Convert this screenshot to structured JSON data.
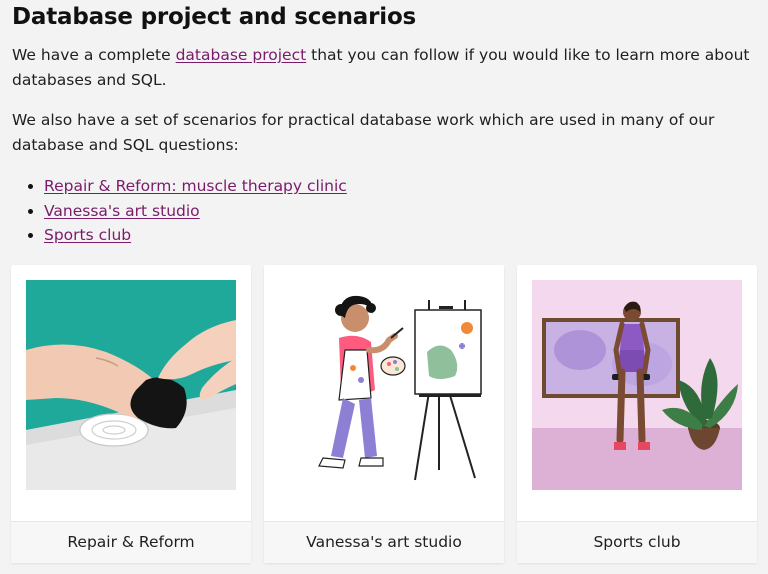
{
  "heading": "Database project and scenarios",
  "intro": {
    "before": "We have a complete ",
    "link": "database project",
    "after": " that you can follow if you would like to learn more about databases and SQL."
  },
  "scenarios_intro": "We also have a set of scenarios for practical database work which are used in many of our database and SQL questions:",
  "scenario_links": [
    "Repair & Reform: muscle therapy clinic",
    "Vanessa's art studio",
    "Sports club"
  ],
  "cards": [
    {
      "caption": "Repair & Reform",
      "icon": "massage-illustration"
    },
    {
      "caption": "Vanessa's art studio",
      "icon": "painter-illustration"
    },
    {
      "caption": "Sports club",
      "icon": "gym-illustration"
    }
  ],
  "colors": {
    "link": "#7a1b6a",
    "background": "#f3f3f3",
    "teal": "#1fa99b",
    "pink_bg": "#f4d9ee"
  }
}
